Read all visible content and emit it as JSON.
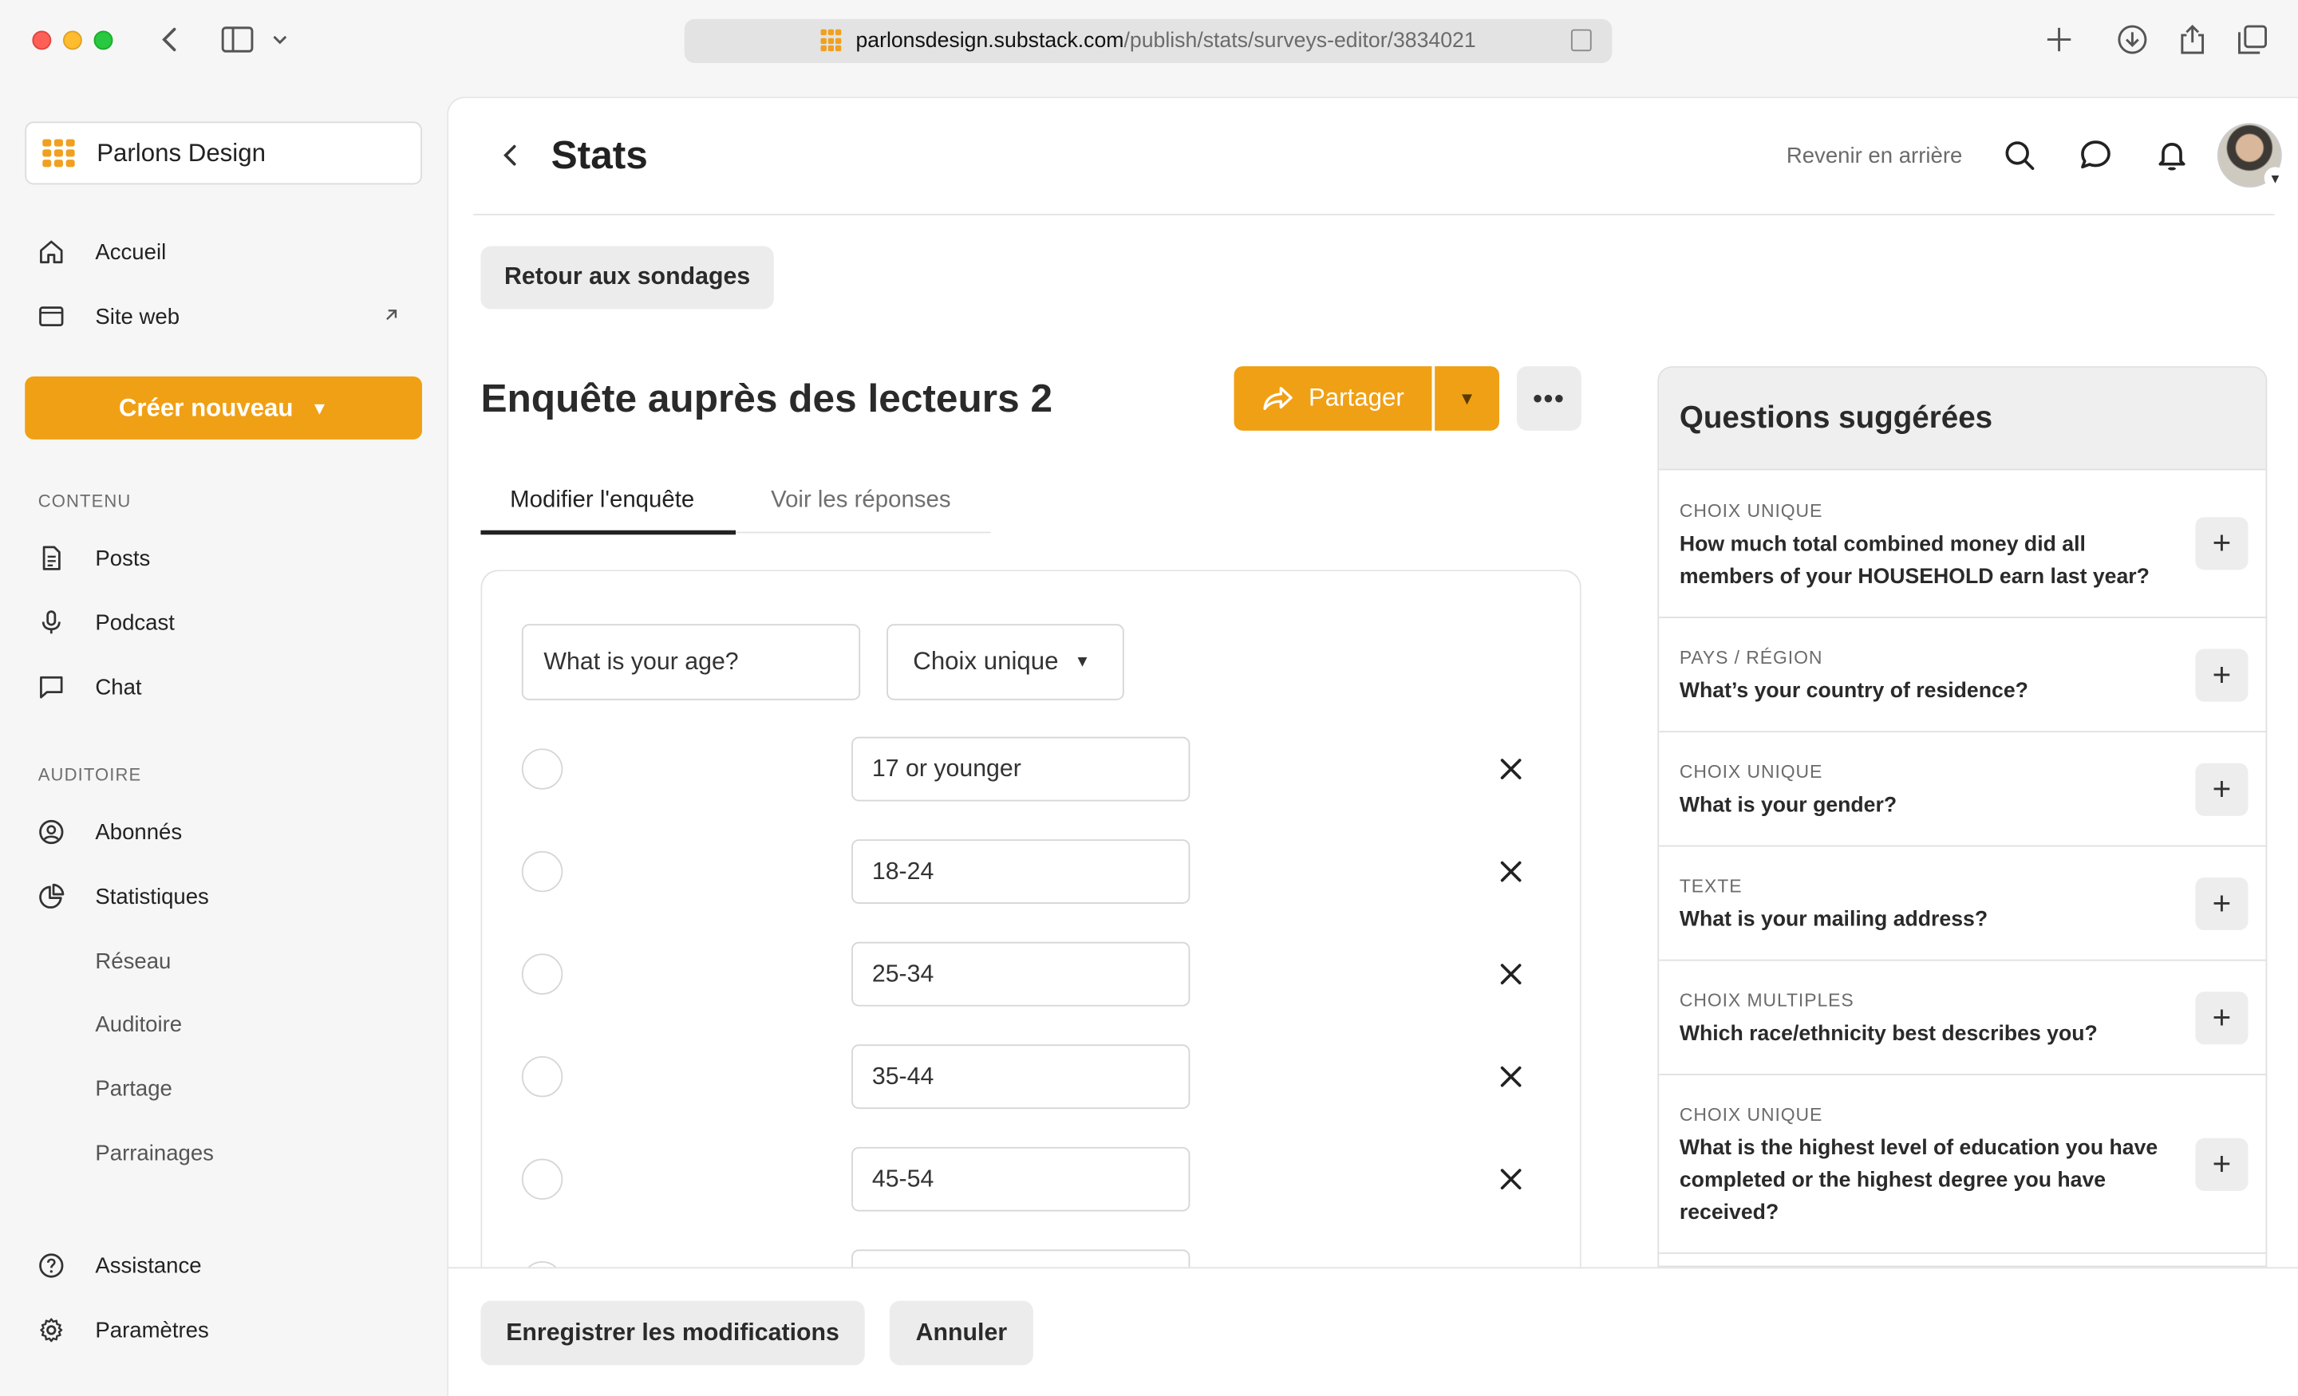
{
  "browser": {
    "url_domain": "parlonsdesign.substack.com",
    "url_path": "/publish/stats/surveys-editor/3834021"
  },
  "sidebar": {
    "publication": "Parlons Design",
    "nav_top": [
      {
        "label": "Accueil",
        "icon": "home-icon"
      },
      {
        "label": "Site web",
        "icon": "browser-window-icon"
      }
    ],
    "create_label": "Créer nouveau",
    "section_content": "CONTENU",
    "content_items": [
      {
        "label": "Posts",
        "icon": "document-icon"
      },
      {
        "label": "Podcast",
        "icon": "microphone-icon"
      },
      {
        "label": "Chat",
        "icon": "chat-bubble-icon"
      }
    ],
    "section_audience": "AUDITOIRE",
    "audience_items": [
      {
        "label": "Abonnés",
        "icon": "user-circle-icon"
      },
      {
        "label": "Statistiques",
        "icon": "pie-chart-icon"
      }
    ],
    "stats_sub_items": [
      "Réseau",
      "Auditoire",
      "Partage",
      "Parrainages"
    ],
    "bottom_items": [
      {
        "label": "Assistance",
        "icon": "help-circle-icon"
      },
      {
        "label": "Paramètres",
        "icon": "gear-icon"
      }
    ]
  },
  "header": {
    "title": "Stats",
    "back_link": "Revenir en arrière"
  },
  "survey": {
    "back_to_surveys": "Retour aux sondages",
    "title": "Enquête auprès des lecteurs 2",
    "share_label": "Partager",
    "tabs": {
      "edit": "Modifier l'enquête",
      "responses": "Voir les réponses"
    },
    "question_value": "What is your age?",
    "question_type": "Choix unique",
    "options": [
      "17 or younger",
      "18-24",
      "25-34",
      "35-44",
      "45-54"
    ]
  },
  "footer": {
    "save_label": "Enregistrer les modifications",
    "cancel_label": "Annuler"
  },
  "suggestions": {
    "title": "Questions suggérées",
    "items": [
      {
        "type": "CHOIX UNIQUE",
        "question": "How much total combined money did all members of your HOUSEHOLD earn last year?"
      },
      {
        "type": "PAYS / RÉGION",
        "question": "What’s your country of residence?"
      },
      {
        "type": "CHOIX UNIQUE",
        "question": "What is your gender?"
      },
      {
        "type": "TEXTE",
        "question": "What is your mailing address?"
      },
      {
        "type": "CHOIX MULTIPLES",
        "question": "Which race/ethnicity best describes you?"
      },
      {
        "type": "CHOIX UNIQUE",
        "question": "What is the highest level of education you have completed or the highest degree you have received?"
      }
    ]
  },
  "colors": {
    "accent": "#f0a014"
  }
}
